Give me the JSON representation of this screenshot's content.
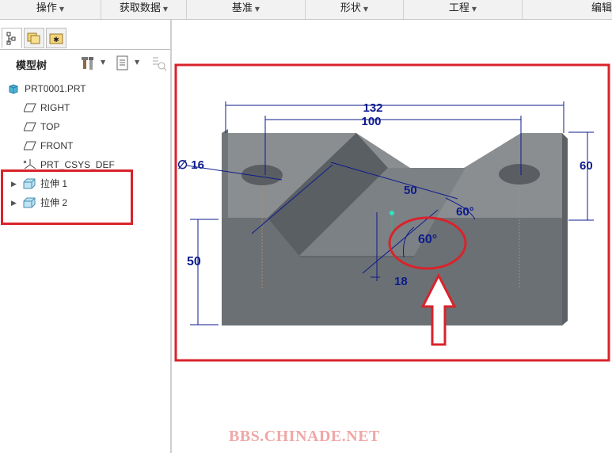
{
  "menubar": {
    "items": [
      {
        "label": "操作"
      },
      {
        "label": "获取数据"
      },
      {
        "label": "基准"
      },
      {
        "label": "形状"
      },
      {
        "label": "工程"
      },
      {
        "label": "编辑"
      }
    ]
  },
  "model_tree": {
    "title": "模型树",
    "items": [
      {
        "label": "PRT0001.PRT",
        "icon": "part-icon",
        "expandable": false
      },
      {
        "label": "RIGHT",
        "icon": "datum-plane-icon",
        "expandable": false
      },
      {
        "label": "TOP",
        "icon": "datum-plane-icon",
        "expandable": false
      },
      {
        "label": "FRONT",
        "icon": "datum-plane-icon",
        "expandable": false
      },
      {
        "label": "PRT_CSYS_DEF",
        "icon": "csys-icon",
        "expandable": false
      },
      {
        "label": "拉伸 1",
        "icon": "extrude-icon",
        "expandable": true
      },
      {
        "label": "拉伸 2",
        "icon": "extrude-icon",
        "expandable": true
      }
    ]
  },
  "model": {
    "dimensions": {
      "overall_width": "132",
      "hole_spacing": "100",
      "hole_diameter": "∅ 16",
      "height_right": "60",
      "slope_length": "50",
      "angle_a": "60°",
      "angle_b": "60°",
      "bottom_width": "18",
      "height_left": "50"
    }
  },
  "watermark": "BBS.CHINADE.NET",
  "colors": {
    "highlight_red": "#d9232b",
    "dimension_blue": "#0d1b8c",
    "model_gray": "#6b7074"
  }
}
